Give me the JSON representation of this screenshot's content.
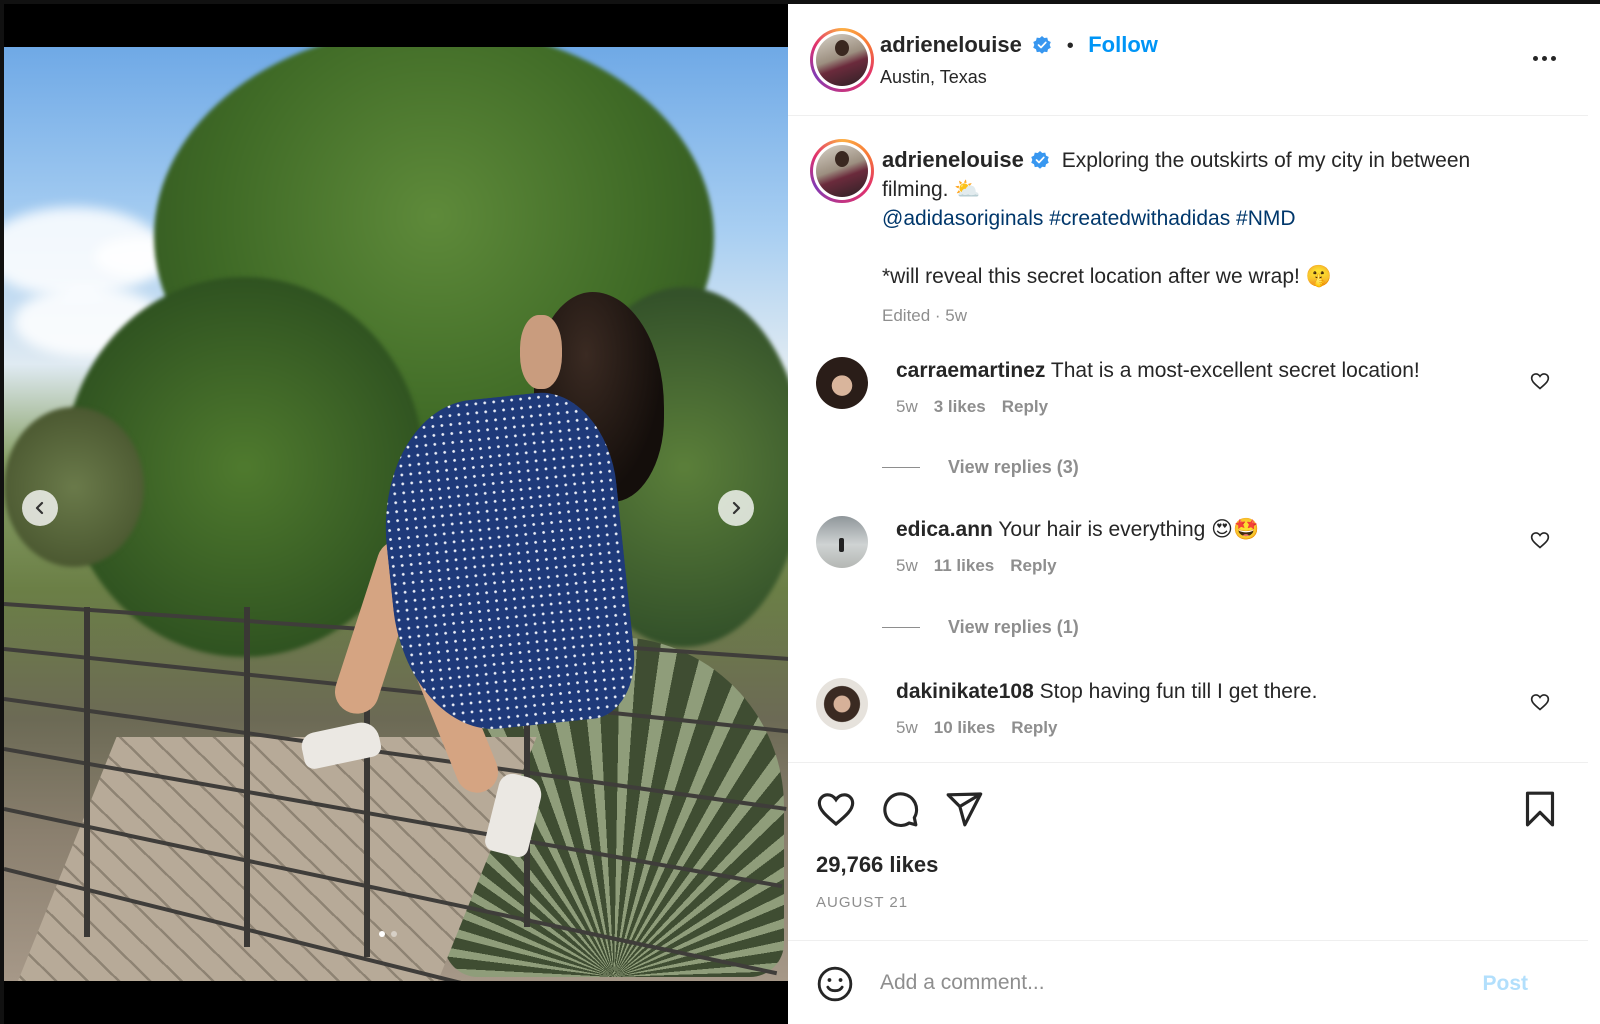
{
  "post": {
    "username": "adrienelouise",
    "follow_label": "Follow",
    "separator": "•",
    "location": "Austin, Texas",
    "caption_line1": "Exploring the outskirts of my city in between filming. ⛅",
    "caption_tags": "@adidasoriginals #createdwithadidas #NMD",
    "caption_line2": "*will reveal this secret location after we wrap! 🤫",
    "caption_meta": "Edited · 5w",
    "likes": "29,766 likes",
    "date": "AUGUST 21"
  },
  "comments": [
    {
      "username": "carraemartinez",
      "text": "That is a most-excellent secret location!",
      "age": "5w",
      "likes": "3 likes",
      "reply": "Reply",
      "view_replies": "View replies (3)"
    },
    {
      "username": "edica.ann",
      "text": "Your hair is everything 😍🤩",
      "age": "5w",
      "likes": "11 likes",
      "reply": "Reply",
      "view_replies": "View replies (1)"
    },
    {
      "username": "dakinikate108",
      "text": "Stop having fun till I get there.",
      "age": "5w",
      "likes": "10 likes",
      "reply": "Reply"
    }
  ],
  "composer": {
    "placeholder": "Add a comment...",
    "post_label": "Post"
  },
  "carousel": {
    "slide_count": 2,
    "active_slide": 1
  },
  "colors": {
    "accent": "#0095f6",
    "link": "#00376b",
    "muted": "#8e8e8e",
    "post_disabled": "#b2dffc"
  },
  "icons": [
    "verified-badge-icon",
    "more-options-icon",
    "heart-icon",
    "comment-icon",
    "share-icon",
    "bookmark-icon",
    "emoji-icon",
    "chevron-left-icon",
    "chevron-right-icon"
  ]
}
